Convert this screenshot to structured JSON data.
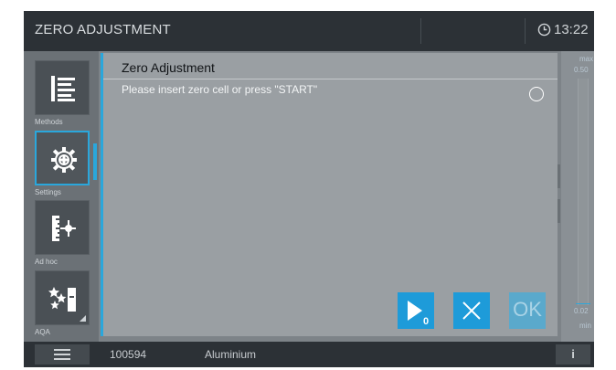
{
  "header": {
    "title": "ZERO ADJUSTMENT",
    "time": "13:22"
  },
  "sidebar": {
    "items": [
      {
        "label": "Methods",
        "icon": "methods-list-icon"
      },
      {
        "label": "Settings",
        "icon": "gear-icon",
        "selected": true
      },
      {
        "label": "Ad hoc",
        "icon": "ruler-target-icon"
      },
      {
        "label": "AQA",
        "icon": "stars-cuvette-icon"
      }
    ]
  },
  "scale": {
    "max_label": "max",
    "max_value": "0.50",
    "min_value": "0.02",
    "min_label": "min"
  },
  "dialog": {
    "title": "Zero Adjustment",
    "message": "Please insert zero cell or press \"START\"",
    "start_subscript": "0",
    "ok_label": "OK"
  },
  "footer": {
    "batch": "100594",
    "material": "Aluminium",
    "info_label": "i"
  },
  "colors": {
    "accent": "#2aa7dc",
    "button": "#1e9bd9",
    "topbar": "#2c3136"
  }
}
